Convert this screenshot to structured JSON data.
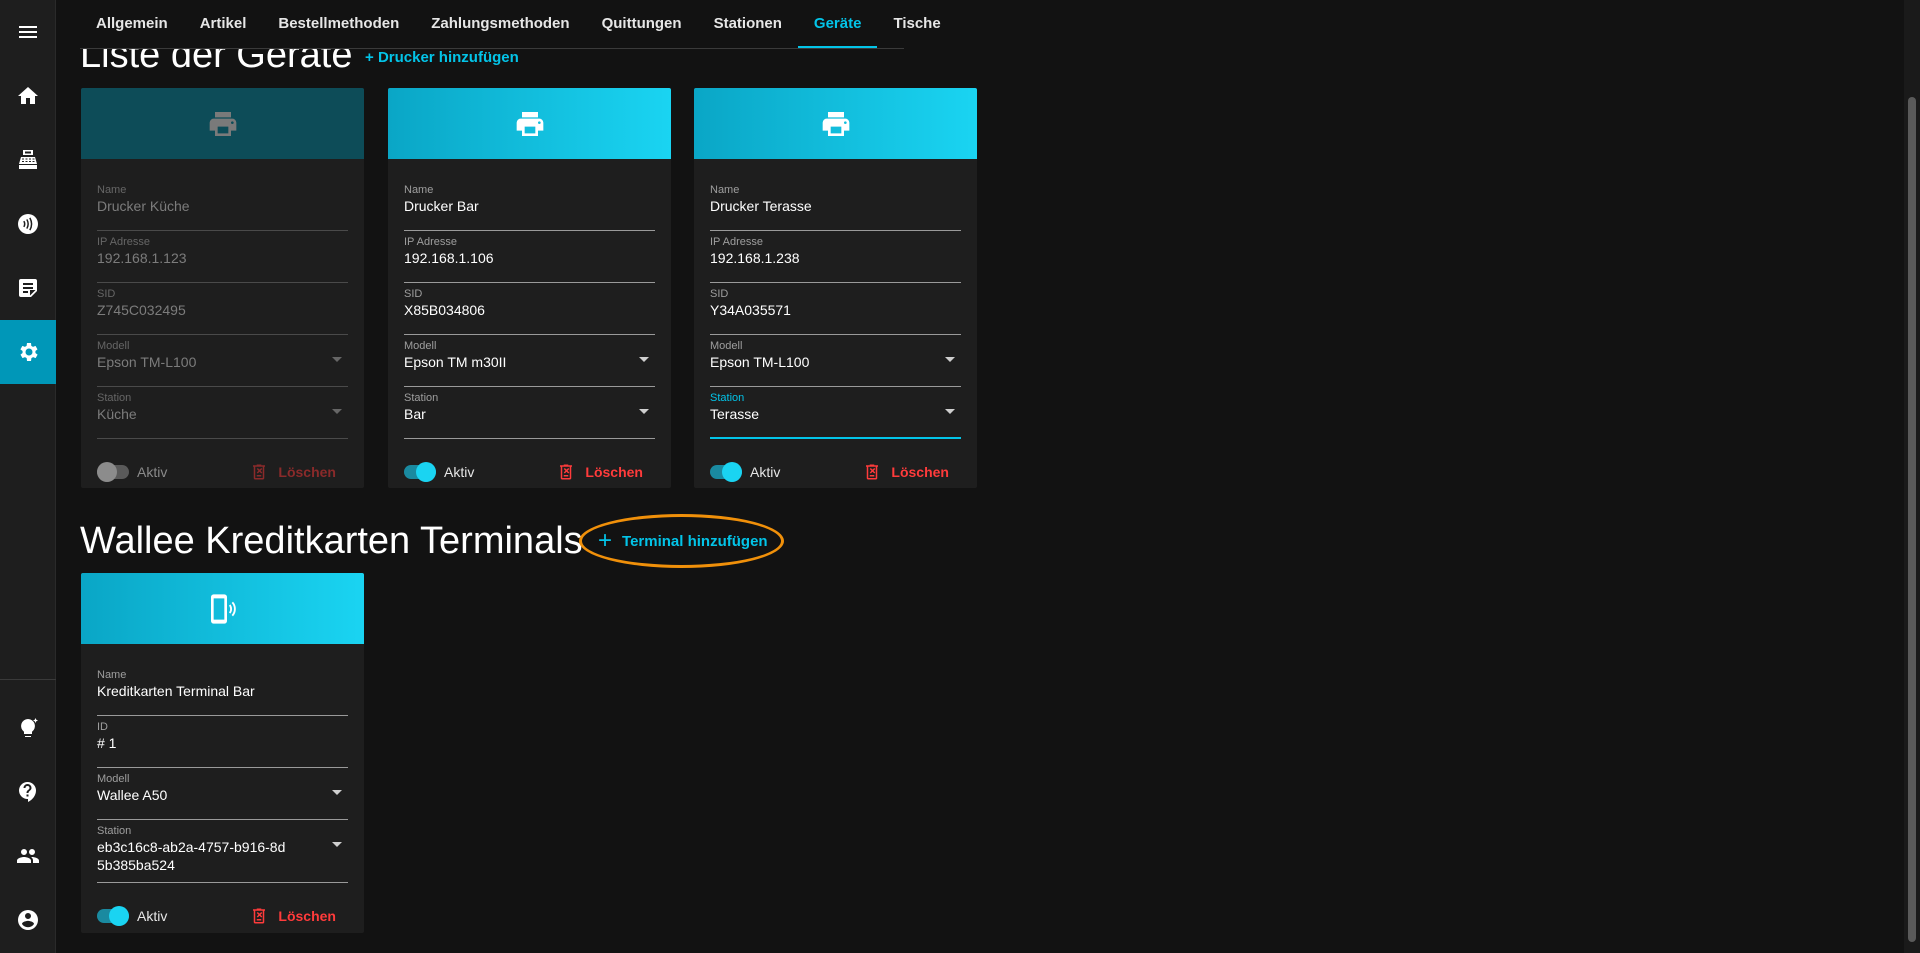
{
  "tabs": [
    "Allgemein",
    "Artikel",
    "Bestellmethoden",
    "Zahlungsmethoden",
    "Quittungen",
    "Stationen",
    "Geräte",
    "Tische"
  ],
  "active_tab": "Geräte",
  "sidebar": {
    "top_icons": [
      "menu-icon",
      "home-icon",
      "cash-register-icon",
      "contactless-icon",
      "receipt-icon",
      "settings-icon"
    ],
    "bottom_icons": [
      "lightbulb-icon",
      "help-icon",
      "users-icon",
      "account-icon"
    ],
    "active": "settings-icon"
  },
  "printers_section": {
    "title": "Liste der Geräte",
    "add_label": "Drucker hinzufügen"
  },
  "printers": [
    {
      "enabled": false,
      "name_label": "Name",
      "name": "Drucker Küche",
      "ip_label": "IP Adresse",
      "ip": "192.168.1.123",
      "sid_label": "SID",
      "sid": "Z745C032495",
      "model_label": "Modell",
      "model": "Epson TM-L100",
      "station_label": "Station",
      "station": "Küche",
      "active_label": "Aktiv",
      "delete_label": "Löschen"
    },
    {
      "enabled": true,
      "name_label": "Name",
      "name": "Drucker Bar",
      "ip_label": "IP Adresse",
      "ip": "192.168.1.106",
      "sid_label": "SID",
      "sid": "X85B034806",
      "model_label": "Modell",
      "model": "Epson TM m30II",
      "station_label": "Station",
      "station": "Bar",
      "active_label": "Aktiv",
      "delete_label": "Löschen"
    },
    {
      "enabled": true,
      "name_label": "Name",
      "name": "Drucker Terasse",
      "ip_label": "IP Adresse",
      "ip": "192.168.1.238",
      "sid_label": "SID",
      "sid": "Y34A035571",
      "model_label": "Modell",
      "model": "Epson TM-L100",
      "station_label": "Station",
      "station": "Terasse",
      "active_label": "Aktiv",
      "delete_label": "Löschen"
    }
  ],
  "terminals_section": {
    "title": "Wallee Kreditkarten Terminals",
    "add_label": "Terminal hinzufügen"
  },
  "terminals": [
    {
      "enabled": true,
      "name_label": "Name",
      "name": "Kreditkarten Terminal Bar",
      "id_label": "ID",
      "id": "# 1",
      "model_label": "Modell",
      "model": "Wallee A50",
      "station_label": "Station",
      "station": "eb3c16c8-ab2a-4757-b916-8d5b385ba524",
      "active_label": "Aktiv",
      "delete_label": "Löschen"
    }
  ],
  "colors": {
    "accent": "#03c4e8",
    "delete": "#ff3b3b",
    "highlight": "#f0900a"
  }
}
